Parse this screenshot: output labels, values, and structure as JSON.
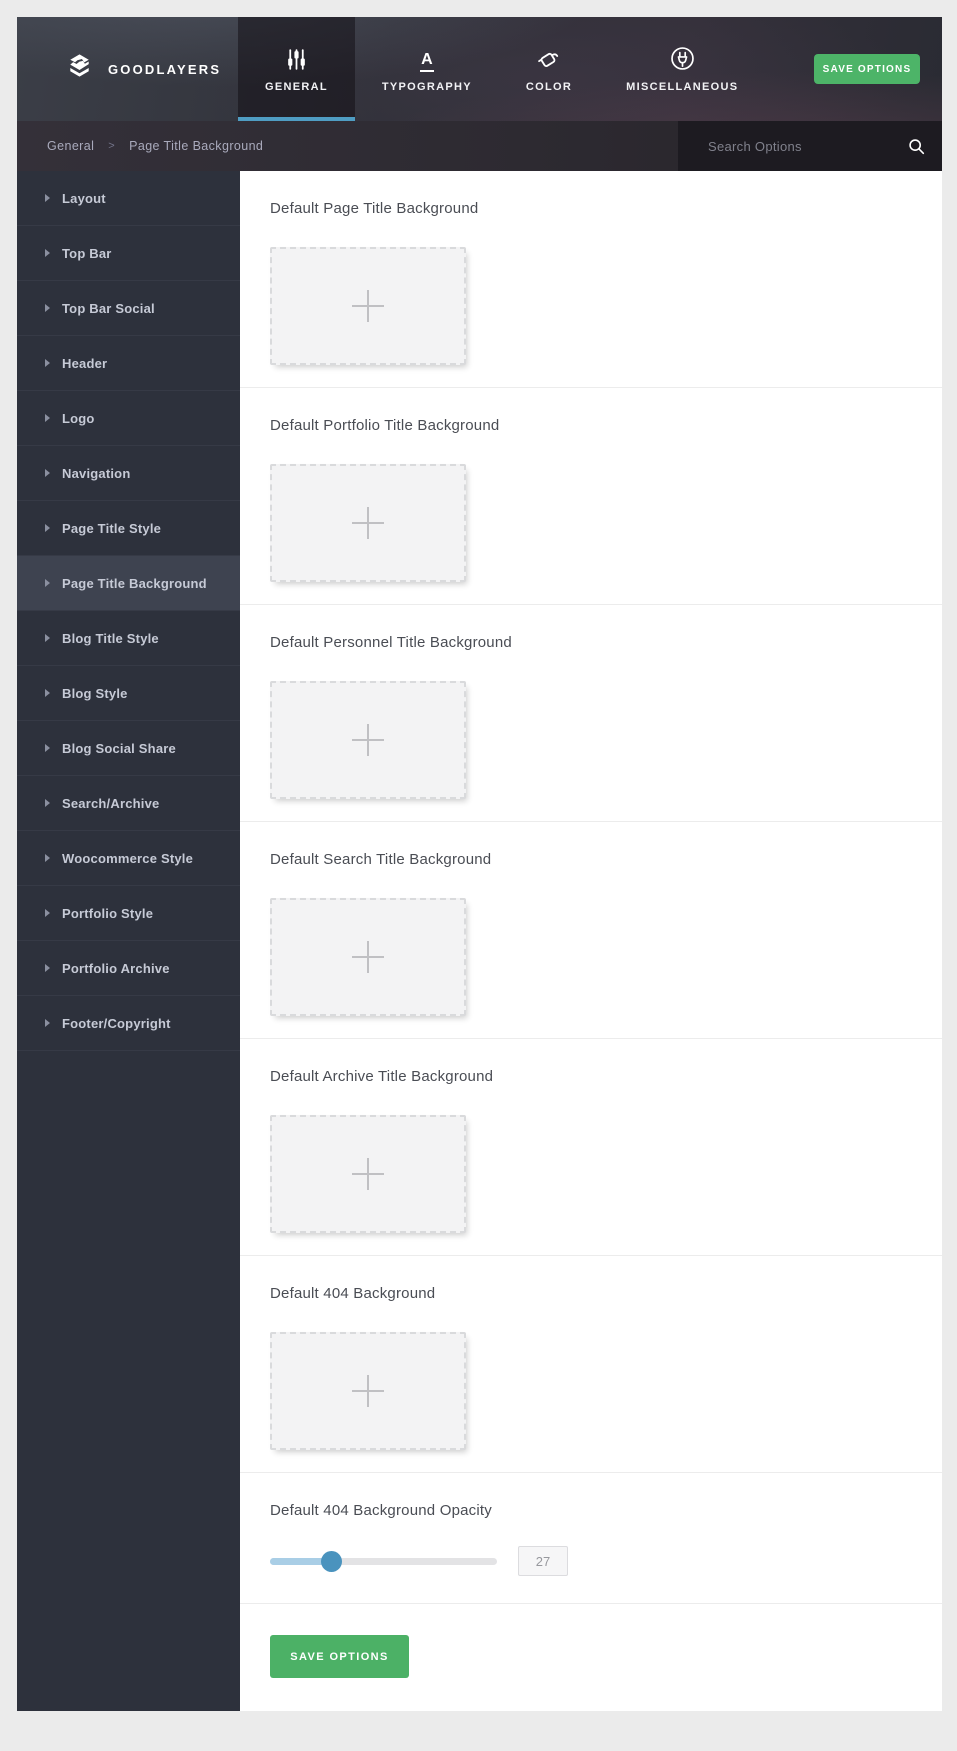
{
  "header": {
    "brand": "GOODLAYERS",
    "tabs": [
      {
        "label": "GENERAL",
        "icon": "sliders-icon",
        "active": true
      },
      {
        "label": "TYPOGRAPHY",
        "icon": "typography-icon",
        "active": false
      },
      {
        "label": "COLOR",
        "icon": "paint-bucket-icon",
        "active": false
      },
      {
        "label": "MISCELLANEOUS",
        "icon": "plug-icon",
        "active": false
      }
    ],
    "save_button_label": "SAVE OPTIONS"
  },
  "breadcrumb": {
    "root": "General",
    "divider": ">",
    "current": "Page Title Background"
  },
  "search": {
    "placeholder": "Search Options"
  },
  "sidebar": {
    "active_item": "Page Title Background",
    "items": [
      "Layout",
      "Top Bar",
      "Top Bar Social",
      "Header",
      "Logo",
      "Navigation",
      "Page Title Style",
      "Page Title Background",
      "Blog Title Style",
      "Blog Style",
      "Blog Social Share",
      "Search/Archive",
      "Woocommerce Style",
      "Portfolio Style",
      "Portfolio Archive",
      "Footer/Copyright"
    ]
  },
  "main": {
    "sections": [
      {
        "type": "upload",
        "title": "Default Page Title Background"
      },
      {
        "type": "upload",
        "title": "Default Portfolio Title Background"
      },
      {
        "type": "upload",
        "title": "Default Personnel Title Background"
      },
      {
        "type": "upload",
        "title": "Default Search Title Background"
      },
      {
        "type": "upload",
        "title": "Default Archive Title Background"
      },
      {
        "type": "upload",
        "title": "Default 404 Background"
      },
      {
        "type": "slider",
        "title": "Default 404 Background Opacity",
        "value": 27,
        "min": 0,
        "max": 100
      }
    ],
    "save_button_label": "SAVE OPTIONS"
  },
  "colors": {
    "accent_green": "#4db468",
    "tab_underline_blue": "#4f9dc3",
    "slider_fill": "#a9cee6",
    "slider_handle": "#4a93be"
  }
}
